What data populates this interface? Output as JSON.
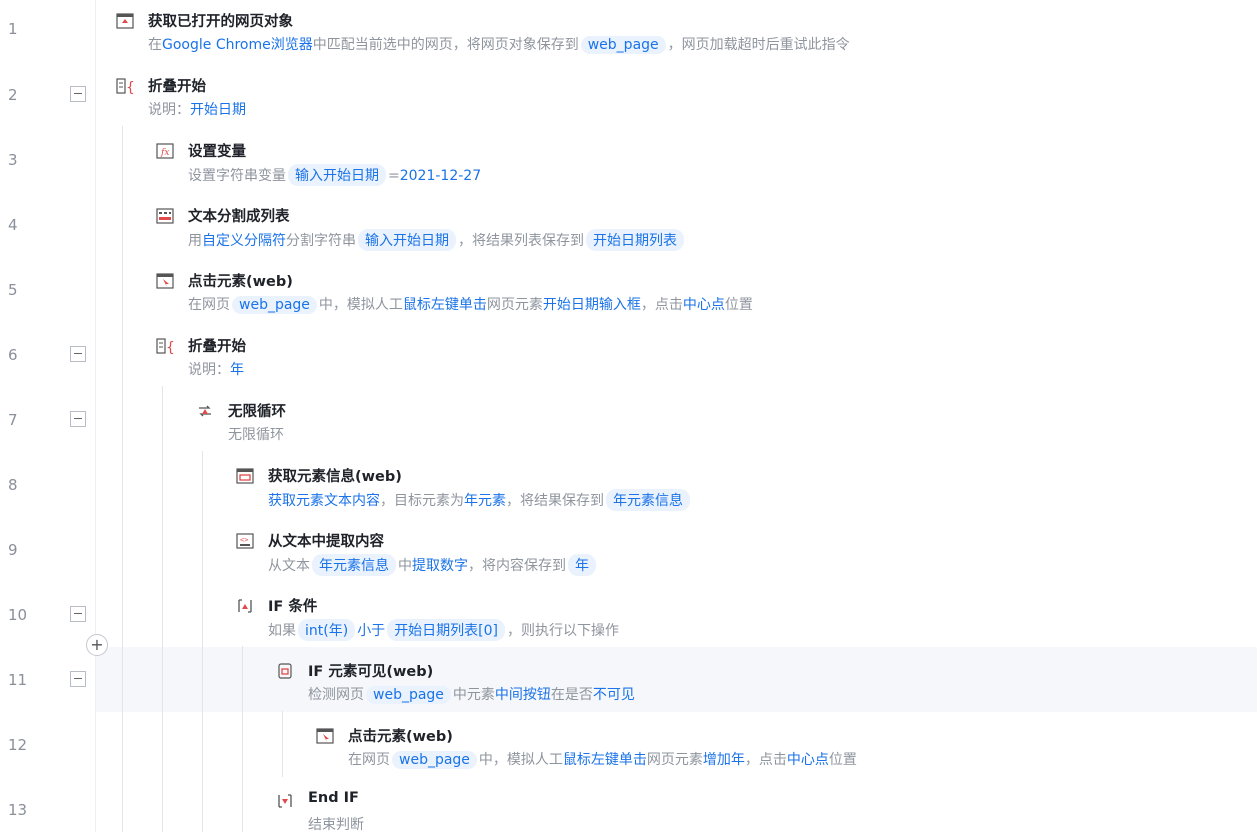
{
  "line_numbers": [
    "1",
    "2",
    "3",
    "4",
    "5",
    "6",
    "7",
    "8",
    "9",
    "10",
    "11",
    "12",
    "13"
  ],
  "add_button": "+",
  "steps": [
    {
      "title": "获取已打开的网页对象",
      "d": [
        "在",
        "Google Chrome浏览器",
        "中匹配当前选中的网页，将网页对象保存到",
        "web_page",
        "，网页加载超时后重试此指令"
      ]
    },
    {
      "title": "折叠开始",
      "d": [
        "说明：",
        "开始日期"
      ]
    },
    {
      "title": "设置变量",
      "d": [
        "设置字符串变量",
        "输入开始日期",
        "=",
        "2021-12-27"
      ]
    },
    {
      "title": "文本分割成列表",
      "d": [
        "用",
        "自定义分隔符",
        "分割字符串",
        "输入开始日期",
        "，将结果列表保存到",
        "开始日期列表"
      ]
    },
    {
      "title": "点击元素(web)",
      "d": [
        "在网页",
        "web_page",
        "中，模拟人工",
        "鼠标左键单击",
        "网页元素",
        "开始日期输入框",
        "，点击",
        "中心点",
        "位置"
      ]
    },
    {
      "title": "折叠开始",
      "d": [
        "说明：",
        "年"
      ]
    },
    {
      "title": "无限循环",
      "d": [
        "无限循环"
      ]
    },
    {
      "title": "获取元素信息(web)",
      "d": [
        "获取元素文本内容",
        "，目标元素为",
        "年元素",
        "，将结果保存到",
        "年元素信息"
      ]
    },
    {
      "title": "从文本中提取内容",
      "d": [
        "从文本",
        "年元素信息",
        "中",
        "提取数字",
        "，将内容保存到",
        "年"
      ]
    },
    {
      "title": "IF 条件",
      "d": [
        "如果",
        "int(年)",
        "小于",
        "开始日期列表[0]",
        "，则执行以下操作"
      ]
    },
    {
      "title": "IF 元素可见(web)",
      "d": [
        "检测网页",
        "web_page",
        "中元素",
        "中间按钮",
        "在是否",
        "不可见"
      ]
    },
    {
      "title": "点击元素(web)",
      "d": [
        "在网页",
        "web_page",
        "中，模拟人工",
        "鼠标左键单击",
        "网页元素",
        "增加年",
        "，点击",
        "中心点",
        "位置"
      ]
    },
    {
      "title": "End IF",
      "d": [
        "结束判断"
      ]
    }
  ]
}
